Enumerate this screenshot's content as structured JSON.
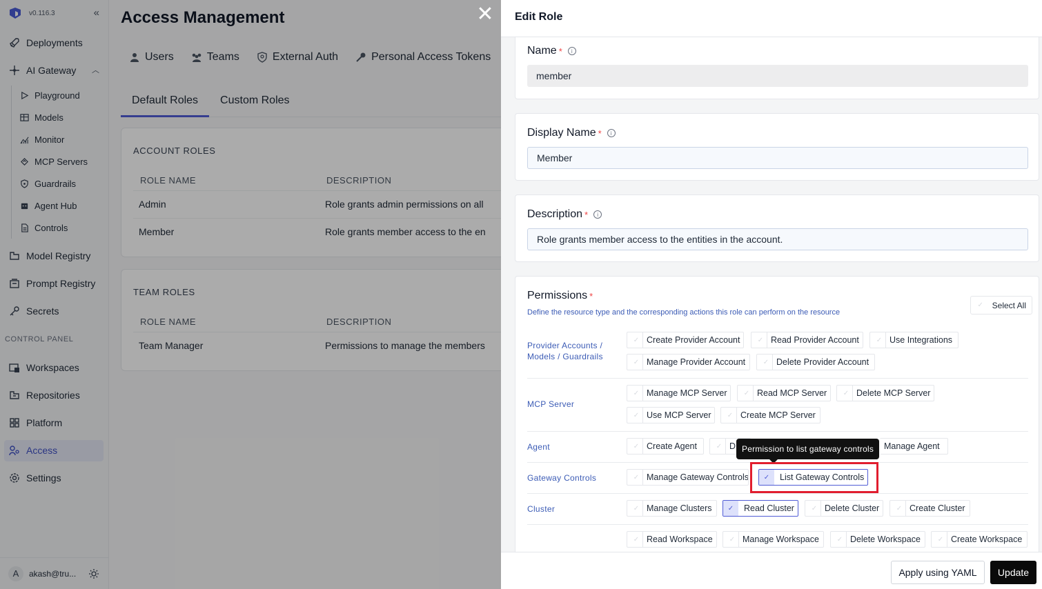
{
  "sidebar": {
    "version": "v0.116.3",
    "items": [
      {
        "label": "Deployments",
        "icon": "rocket-icon"
      },
      {
        "label": "AI Gateway",
        "icon": "gateway-icon"
      },
      {
        "label": "Model Registry",
        "icon": "model-registry-icon"
      },
      {
        "label": "Prompt Registry",
        "icon": "prompt-registry-icon"
      },
      {
        "label": "Secrets",
        "icon": "key-icon"
      }
    ],
    "gateway_subitems": [
      {
        "label": "Playground",
        "icon": "play-icon"
      },
      {
        "label": "Models",
        "icon": "table-icon"
      },
      {
        "label": "Monitor",
        "icon": "chart-icon"
      },
      {
        "label": "MCP Servers",
        "icon": "mcp-icon"
      },
      {
        "label": "Guardrails",
        "icon": "shield-icon"
      },
      {
        "label": "Agent Hub",
        "icon": "robot-icon"
      },
      {
        "label": "Controls",
        "icon": "document-icon"
      }
    ],
    "section_label": "CONTROL PANEL",
    "control_items": [
      {
        "label": "Workspaces",
        "icon": "workspace-icon"
      },
      {
        "label": "Repositories",
        "icon": "repository-icon"
      },
      {
        "label": "Platform",
        "icon": "grid-icon"
      },
      {
        "label": "Access",
        "icon": "users-key-icon"
      },
      {
        "label": "Settings",
        "icon": "gear-icon"
      }
    ],
    "user": {
      "initial": "A",
      "email": "akash@tru..."
    }
  },
  "main": {
    "title": "Access Management",
    "tabs": [
      {
        "label": "Users"
      },
      {
        "label": "Teams"
      },
      {
        "label": "External Auth"
      },
      {
        "label": "Personal Access Tokens"
      }
    ],
    "subtabs": [
      {
        "label": "Default Roles"
      },
      {
        "label": "Custom Roles"
      }
    ],
    "account_roles": {
      "title": "ACCOUNT ROLES",
      "headers": [
        "ROLE NAME",
        "DESCRIPTION"
      ],
      "rows": [
        {
          "name": "Admin",
          "description": "Role grants admin permissions on all"
        },
        {
          "name": "Member",
          "description": "Role grants member access to the en"
        }
      ]
    },
    "team_roles": {
      "title": "TEAM ROLES",
      "headers": [
        "ROLE NAME",
        "DESCRIPTION"
      ],
      "rows": [
        {
          "name": "Team Manager",
          "description": "Permissions to manage the members"
        }
      ]
    }
  },
  "drawer": {
    "title": "Edit Role",
    "name": {
      "label": "Name",
      "value": "member"
    },
    "display_name": {
      "label": "Display Name",
      "value": "Member"
    },
    "description": {
      "label": "Description",
      "value": "Role grants member access to the entities in the account."
    },
    "permissions": {
      "label": "Permissions",
      "description": "Define the resource type and the corresponding actions this role can perform on the resource",
      "select_all": "Select All",
      "groups": [
        {
          "label_lines": [
            "Provider Accounts /",
            "Models / Guardrails"
          ],
          "perms": [
            {
              "label": "Create Provider Account",
              "checked": false
            },
            {
              "label": "Read Provider Account",
              "checked": false
            },
            {
              "label": "Use Integrations",
              "checked": false
            },
            {
              "label": "Manage Provider Account",
              "checked": false
            },
            {
              "label": "Delete Provider Account",
              "checked": false
            }
          ]
        },
        {
          "label_lines": [
            "MCP Server"
          ],
          "perms": [
            {
              "label": "Manage MCP Server",
              "checked": false
            },
            {
              "label": "Read MCP Server",
              "checked": false
            },
            {
              "label": "Delete MCP Server",
              "checked": false
            },
            {
              "label": "Use MCP Server",
              "checked": false
            },
            {
              "label": "Create MCP Server",
              "checked": false
            }
          ]
        },
        {
          "label_lines": [
            "Agent"
          ],
          "perms": [
            {
              "label": "Create Agent",
              "checked": false
            },
            {
              "label": "D",
              "checked": false
            },
            {
              "label": "Manage Agent",
              "checked": false
            }
          ]
        },
        {
          "label_lines": [
            "Gateway Controls"
          ],
          "perms": [
            {
              "label": "Manage Gateway Controls",
              "checked": false
            },
            {
              "label": "List Gateway Controls",
              "checked": true
            }
          ]
        },
        {
          "label_lines": [
            "Cluster"
          ],
          "perms": [
            {
              "label": "Manage Clusters",
              "checked": false
            },
            {
              "label": "Read Cluster",
              "checked": true
            },
            {
              "label": "Delete Cluster",
              "checked": false
            },
            {
              "label": "Create Cluster",
              "checked": false
            }
          ]
        },
        {
          "label_lines": [],
          "perms": [
            {
              "label": "Read Workspace",
              "checked": false
            },
            {
              "label": "Manage Workspace",
              "checked": false
            },
            {
              "label": "Delete Workspace",
              "checked": false
            },
            {
              "label": "Create Workspace",
              "checked": false
            }
          ]
        }
      ],
      "tooltip": "Permission to list gateway controls"
    },
    "buttons": {
      "apply_yaml": "Apply using YAML",
      "update": "Update"
    }
  },
  "colors": {
    "accent": "#4f5bd5",
    "highlight": "#e11d2e",
    "link_blue": "#3b5bb5"
  }
}
